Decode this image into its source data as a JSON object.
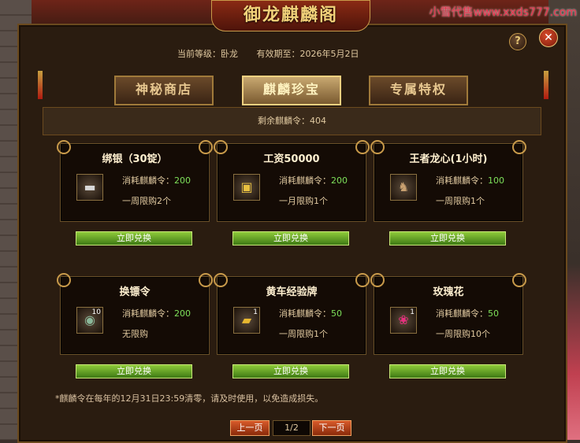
{
  "window": {
    "title": "御龙麒麟阁",
    "watermark": "小雪代售www.xxds777.com"
  },
  "controls": {
    "help": "?",
    "close": "✕"
  },
  "info": {
    "level": "当前等级：卧龙",
    "expiry": "有效期至：2026年5月2日"
  },
  "tabs": [
    {
      "label": "神秘商店",
      "active": false
    },
    {
      "label": "麒麟珍宝",
      "active": true
    },
    {
      "label": "专属特权",
      "active": false
    }
  ],
  "remaining": "剩余麒麟令：404",
  "items": [
    {
      "name": "绑银（30锭）",
      "cost_label": "消耗麒麟令：",
      "cost": "200",
      "limit": "一周限购2个",
      "icon": "silver-ingot-icon",
      "qty": "",
      "button": "立即兑换"
    },
    {
      "name": "工资50000",
      "cost_label": "消耗麒麟令：",
      "cost": "200",
      "limit": "一月限购1个",
      "icon": "salary-box-icon",
      "qty": "",
      "button": "立即兑换"
    },
    {
      "name": "王者龙心(1小时)",
      "cost_label": "消耗麒麟令：",
      "cost": "100",
      "limit": "一周限购1个",
      "icon": "dragon-heart-icon",
      "qty": "",
      "button": "立即兑换"
    },
    {
      "name": "换镖令",
      "cost_label": "消耗麒麟令：",
      "cost": "200",
      "limit": "无限购",
      "icon": "escort-token-icon",
      "qty": "10",
      "button": "立即兑换"
    },
    {
      "name": "黄车经验牌",
      "cost_label": "消耗麒麟令：",
      "cost": "50",
      "limit": "一周限购1个",
      "icon": "yellow-cart-icon",
      "qty": "1",
      "button": "立即兑换"
    },
    {
      "name": "玫瑰花",
      "cost_label": "消耗麒麟令：",
      "cost": "50",
      "limit": "一周限购10个",
      "icon": "rose-icon",
      "qty": "1",
      "button": "立即兑换"
    }
  ],
  "note": "*麒麟令在每年的12月31日23:59清零，请及时使用，以免造成损失。",
  "pager": {
    "prev": "上一页",
    "page": "1/2",
    "next": "下一页"
  },
  "colors": {
    "accent": "#c89a4a",
    "cost_value": "#7ee05a",
    "button": "#6aa82a"
  }
}
